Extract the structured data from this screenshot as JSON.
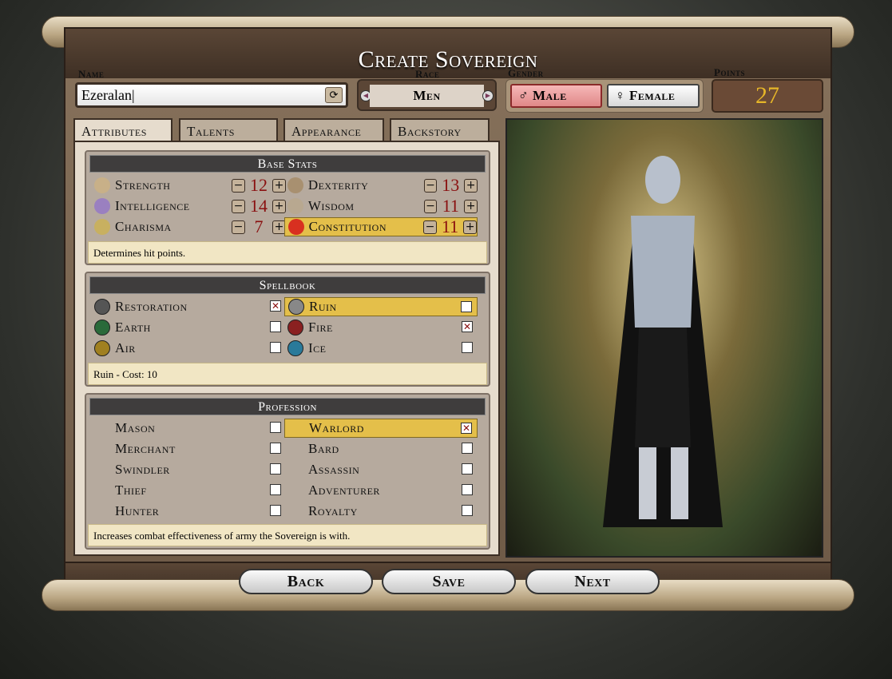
{
  "title": "Create Sovereign",
  "name": {
    "label": "Name",
    "value": "Ezeralan"
  },
  "race": {
    "label": "Race",
    "value": "Men"
  },
  "gender": {
    "label": "Gender",
    "male": "Male",
    "female": "Female",
    "selected": "Male"
  },
  "points": {
    "label": "Points",
    "value": "27"
  },
  "tabs": [
    "Attributes",
    "Talents",
    "Appearance",
    "Backstory"
  ],
  "base_stats": {
    "title": "Base Stats",
    "stats": [
      {
        "name": "Strength",
        "value": "12",
        "icon": "arm-icon"
      },
      {
        "name": "Dexterity",
        "value": "13",
        "icon": "hand-icon"
      },
      {
        "name": "Intelligence",
        "value": "14",
        "icon": "brain-icon"
      },
      {
        "name": "Wisdom",
        "value": "11",
        "icon": "eye-icon"
      },
      {
        "name": "Charisma",
        "value": "7",
        "icon": "figure-icon"
      },
      {
        "name": "Constitution",
        "value": "11",
        "icon": "heart-icon",
        "highlight": true
      }
    ],
    "description": "Determines hit points."
  },
  "spellbook": {
    "title": "Spellbook",
    "spells": [
      {
        "name": "Restoration",
        "checked": true
      },
      {
        "name": "Ruin",
        "checked": false,
        "highlight": true
      },
      {
        "name": "Earth",
        "checked": false
      },
      {
        "name": "Fire",
        "checked": true
      },
      {
        "name": "Air",
        "checked": false
      },
      {
        "name": "Ice",
        "checked": false
      }
    ],
    "description": "Ruin - Cost: 10"
  },
  "profession": {
    "title": "Profession",
    "items": [
      {
        "name": "Mason",
        "checked": false
      },
      {
        "name": "Warlord",
        "checked": true,
        "highlight": true
      },
      {
        "name": "Merchant",
        "checked": false
      },
      {
        "name": "Bard",
        "checked": false
      },
      {
        "name": "Swindler",
        "checked": false
      },
      {
        "name": "Assassin",
        "checked": false
      },
      {
        "name": "Thief",
        "checked": false
      },
      {
        "name": "Adventurer",
        "checked": false
      },
      {
        "name": "Hunter",
        "checked": false
      },
      {
        "name": "Royalty",
        "checked": false
      }
    ],
    "description": "Increases combat effectiveness of army the Sovereign is with."
  },
  "buttons": {
    "back": "Back",
    "save": "Save",
    "next": "Next"
  },
  "colors": {
    "highlight": "#e4bf4a",
    "value": "#8a1010",
    "points": "#e6b628"
  }
}
